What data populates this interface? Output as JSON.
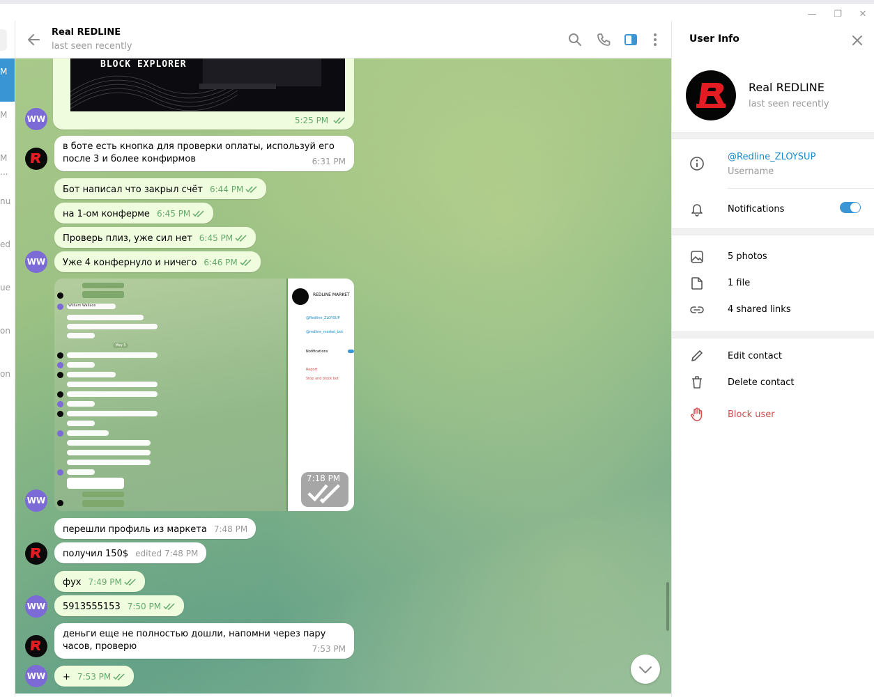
{
  "window": {
    "minimize_glyph": "—",
    "maximize_glyph": "❐",
    "close_glyph": "✕"
  },
  "left_list": {
    "fragments": [
      "M",
      "M",
      "M",
      "...",
      "nu",
      "ed",
      "ue",
      "on",
      "on"
    ]
  },
  "header": {
    "title": "Real REDLINE",
    "status": "last seen recently",
    "icons": [
      "back-arrow-icon",
      "search-icon",
      "phone-icon",
      "sidebar-panel-icon",
      "more-vertical-icon"
    ]
  },
  "messages": {
    "banner_text": "BLOCK EXPLORER",
    "banner_time": "5:25 PM",
    "m1_text": "в боте есть кнопка для проверки оплаты, используй его после 3 и более конфирмов",
    "m1_time": "6:31 PM",
    "m2_text": "Бот написал что закрыл счёт",
    "m2_time": "6:44 PM",
    "m3_text": "на 1-ом конферме",
    "m3_time": "6:45 PM",
    "m4_text": "Проверь плиз, уже сил нет",
    "m4_time": "6:45 PM",
    "m5_text": "Уже 4 конфернуло и ничего",
    "m5_time": "6:46 PM",
    "photo_time": "7:18 PM",
    "m6_text": "перешли профиль из маркета",
    "m6_time": "7:48 PM",
    "m7_text": "получил 150$",
    "m7_time": "edited 7:48 PM",
    "m8_text": "фух",
    "m8_time": "7:49 PM",
    "m9_text": "5913555153",
    "m9_time": "7:50 PM",
    "m10_text": "деньги еще не полностью дошли, напомни через пару часов, проверю",
    "m10_time": "7:53 PM",
    "m11_text": "+",
    "m11_time": "7:53 PM"
  },
  "screenshot_content": {
    "market_name": "REDLINE MARKET",
    "link1": "@Redline_ZLOYSUP",
    "link2": "@redline_market_bot",
    "notif": "Notifications",
    "report": "Report",
    "stop": "Stop and block bot",
    "date_pill": "May 5",
    "sender": "William Wallace"
  },
  "avatars": {
    "ww_initials": "WW"
  },
  "panel": {
    "title": "User Info",
    "name": "Real REDLINE",
    "status": "last seen recently",
    "username": "@Redline_ZLOYSUP",
    "username_label": "Username",
    "notifications": "Notifications",
    "notifications_on": true,
    "photos": "5 photos",
    "files": "1 file",
    "links": "4 shared links",
    "edit": "Edit contact",
    "delete": "Delete contact",
    "block": "Block user"
  },
  "colors": {
    "accent": "#3a95d5",
    "outgoing_bubble": "#effdde",
    "outgoing_time": "#63a96c",
    "danger": "#d14e4e",
    "link": "#168acd",
    "ww_avatar": "#7c6ad6"
  }
}
